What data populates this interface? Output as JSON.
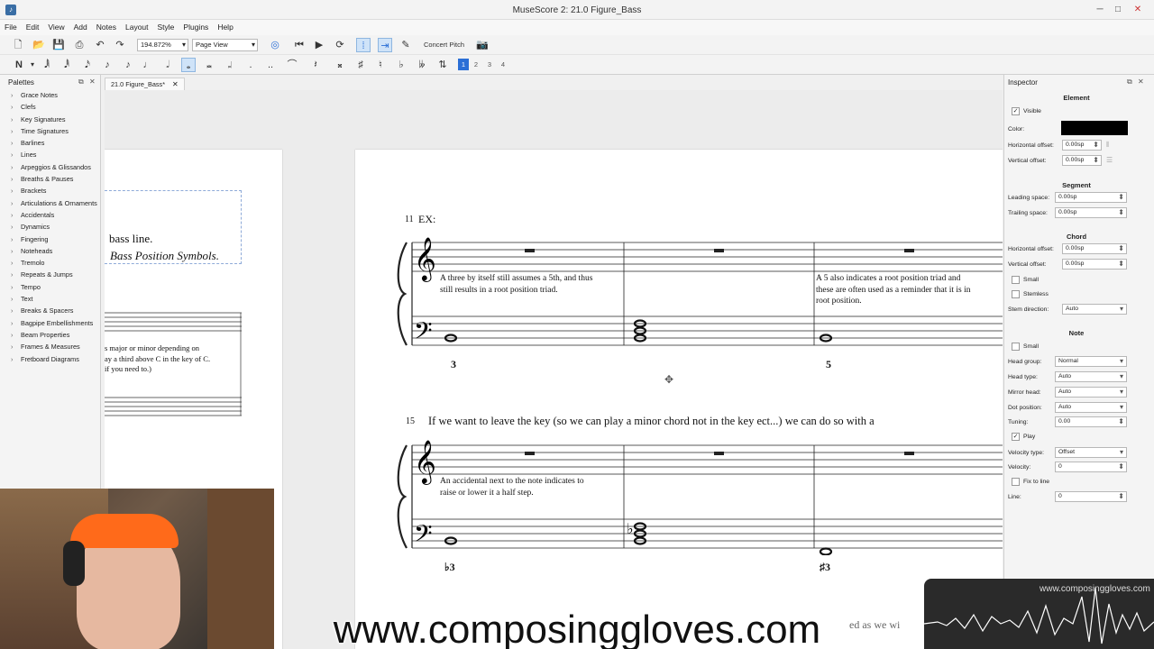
{
  "window": {
    "title": "MuseScore 2: 21.0 Figure_Bass"
  },
  "menu": [
    "File",
    "Edit",
    "View",
    "Add",
    "Notes",
    "Layout",
    "Style",
    "Plugins",
    "Help"
  ],
  "toolbar": {
    "zoom": "194.872%",
    "view_mode": "Page View",
    "concert_pitch": "Concert Pitch",
    "voices": [
      "1",
      "2",
      "3",
      "4"
    ]
  },
  "palettes": {
    "title": "Palettes",
    "items": [
      "Grace Notes",
      "Clefs",
      "Key Signatures",
      "Time Signatures",
      "Barlines",
      "Lines",
      "Arpeggios & Glissandos",
      "Breaths & Pauses",
      "Brackets",
      "Articulations & Ornaments",
      "Accidentals",
      "Dynamics",
      "Fingering",
      "Noteheads",
      "Tremolo",
      "Repeats & Jumps",
      "Tempo",
      "Text",
      "Breaks & Spacers",
      "Bagpipe Embellishments",
      "Beam Properties",
      "Frames & Measures",
      "Fretboard Diagrams"
    ]
  },
  "tab": {
    "label": "21.0 Figure_Bass*"
  },
  "score": {
    "left_page": {
      "line1": "bass line.",
      "line2": "Bass Position Symbols.",
      "box_text": [
        "s major or minor depending on",
        "ay a third above C in the key of C.",
        " if you need to.)"
      ]
    },
    "system1": {
      "measure_number": "11",
      "ex_label": "EX:",
      "text_a": [
        "A three by itself still assumes a 5th, and thus",
        "still results in a root position triad."
      ],
      "text_b": [
        "A 5 also indicates a root position triad and",
        "these are often used as a reminder that it is in",
        "root position."
      ],
      "figures": [
        "3",
        "5"
      ]
    },
    "system2": {
      "measure_number": "15",
      "title": "If we want to leave the key (so we can play a minor chord not in the key ect...) we can do so with a",
      "text_a": [
        "An accidental next to the note indicates to",
        "raise or lower it a half step."
      ],
      "figures": [
        "♭3",
        "♯3"
      ]
    },
    "bottom_fragment": "ed as we wi"
  },
  "inspector": {
    "title": "Inspector",
    "element": {
      "header": "Element",
      "visible_label": "Visible",
      "color_label": "Color:",
      "color_value": "#000000",
      "h_offset_label": "Horizontal offset:",
      "h_offset": "0.00sp",
      "v_offset_label": "Vertical offset:",
      "v_offset": "0.00sp"
    },
    "segment": {
      "header": "Segment",
      "leading_label": "Leading space:",
      "leading": "0.00sp",
      "trailing_label": "Trailing space:",
      "trailing": "0.00sp"
    },
    "chord": {
      "header": "Chord",
      "h_offset_label": "Horizontal offset:",
      "h_offset": "0.00sp",
      "v_offset_label": "Vertical offset:",
      "v_offset": "0.00sp",
      "small_label": "Small",
      "stemless_label": "Stemless",
      "stem_dir_label": "Stem direction:",
      "stem_dir": "Auto"
    },
    "note": {
      "header": "Note",
      "small_label": "Small",
      "head_group_label": "Head group:",
      "head_group": "Normal",
      "head_type_label": "Head type:",
      "head_type": "Auto",
      "mirror_label": "Mirror head:",
      "mirror": "Auto",
      "dot_label": "Dot position:",
      "dot": "Auto",
      "tuning_label": "Tuning:",
      "tuning": "0.00",
      "play_label": "Play",
      "velocity_type_label": "Velocity type:",
      "velocity_type": "Offset",
      "velocity_label": "Velocity:",
      "velocity": "0",
      "fix_label": "Fix to line",
      "line_label": "Line:",
      "line": "0"
    }
  },
  "overlay": {
    "watermark_small": "www.composinggloves.com",
    "watermark_big": "www.composinggloves.com"
  }
}
